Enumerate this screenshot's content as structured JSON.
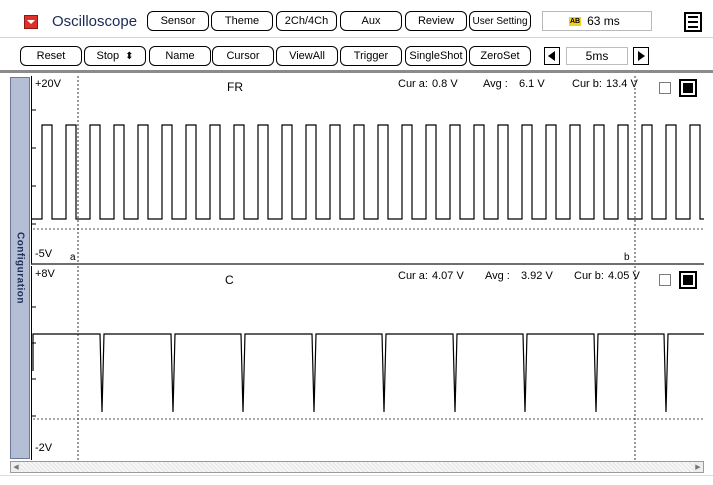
{
  "header": {
    "title": "Oscilloscope",
    "menu_icon": "dropdown-icon",
    "nav_buttons": [
      "Sensor",
      "Theme",
      "2Ch/4Ch",
      "Aux",
      "Review",
      "User Setting"
    ],
    "sample_rate_icon": "AB",
    "sample_rate": "63 ms",
    "menu_right_icon": "hamburger-menu-icon"
  },
  "toolbar": {
    "reset": "Reset",
    "stop": "Stop",
    "stop_spinner": "⬍",
    "name": "Name",
    "cursor": "Cursor",
    "viewall": "ViewAll",
    "trigger": "Trigger",
    "singleshot": "SingleShot",
    "zeroset": "ZeroSet",
    "timebase": "5ms"
  },
  "sidebar": {
    "label": "Configuration"
  },
  "channels": [
    {
      "name": "FR",
      "y_max": "+20V",
      "y_min": "-5V",
      "cur_a_label": "Cur a:",
      "cur_a": "0.8 V",
      "avg_label": "Avg :",
      "avg": "6.1 V",
      "cur_b_label": "Cur b:",
      "cur_b": "13.4 V",
      "marker_a": "a",
      "marker_b": "b"
    },
    {
      "name": "C",
      "y_max": "+8V",
      "y_min": "-2V",
      "cur_a_label": "Cur a:",
      "cur_a": "4.07 V",
      "avg_label": "Avg :",
      "avg": "3.92 V",
      "cur_b_label": "Cur b:",
      "cur_b": "4.05 V"
    }
  ],
  "colors": {
    "title": "#1a2a55",
    "accent": "#e0302a",
    "sidebar": "#b4bfd6"
  }
}
